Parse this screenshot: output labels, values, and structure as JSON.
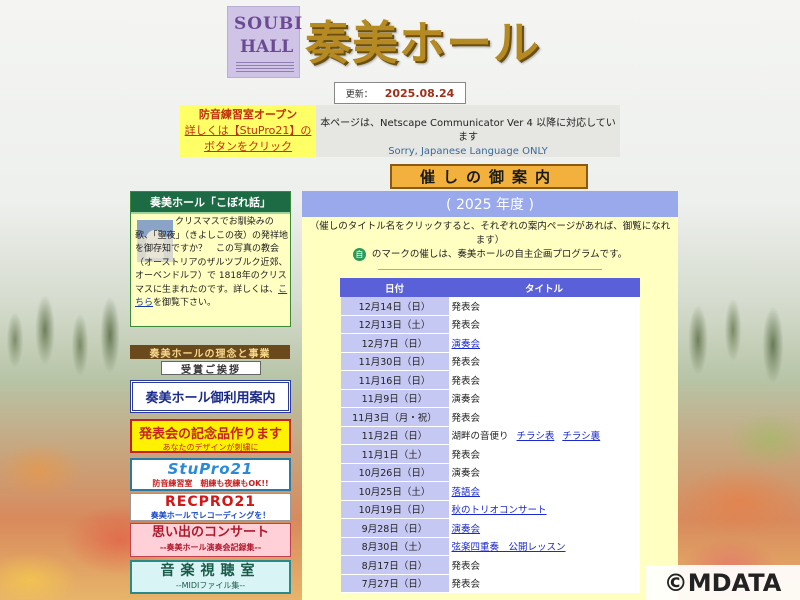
{
  "header": {
    "logo_line1": "SOUBI",
    "logo_line2": "HALL",
    "title": "奏美ホール",
    "update_label": "更新：",
    "update_date": "2025.08.24"
  },
  "notice": {
    "line1": "防音練習室オープン",
    "line2": "詳しくは【StuPro21】の",
    "line3": "ボタンをクリック",
    "browser_text": "本ページは、Netscape Communicator Ver 4 以降に対応しています",
    "browser_text_en": "Sorry, Japanese Language ONLY"
  },
  "section_title": "催しの御案内",
  "sidebar": {
    "kobore_title": "奏美ホール「こぼれ話」",
    "kobore_text": "クリスマスでお馴染みの歌、「聖夜」（きよしこの夜）の発祥地を御存知ですか？　この写真の教会（オーストリアのザルツブルク近郊、オーベンドルフ）で 1818年のクリスマスに生まれたのです。詳しくは、",
    "kobore_link": "こちら",
    "kobore_tail": "を御覧下さい。",
    "philosophy": "奏美ホールの理念と事業",
    "award": "受賞ご挨拶",
    "usage": "奏美ホール御利用案内",
    "kinen_title": "発表会の記念品作ります",
    "kinen_sub": "あなたのデザインが刺繍に",
    "stupro_title": "StuPro21",
    "stupro_sub": "防音練習室　朝練も夜練もOK!!",
    "rec_title": "RECPRO21",
    "rec_sub": "奏美ホールでレコーディングを！",
    "omoide_title": "思い出のコンサート",
    "omoide_sub": "--奏美ホール演奏会記録集--",
    "ongaku_title": "音楽視聴室",
    "ongaku_sub": "--MIDIファイル集--"
  },
  "main": {
    "year_label": "( 2025 年度 )",
    "intro1": "（催しのタイトル名をクリックすると、それぞれの案内ページがあれば、御覧になれます）",
    "own_mark": "自",
    "intro2": "のマークの催しは、奏美ホールの自主企画プログラムです。",
    "col_date": "日付",
    "col_title": "タイトル",
    "events": [
      {
        "date": "12月14日（日）",
        "title": "発表会",
        "link": false
      },
      {
        "date": "12月13日（土）",
        "title": "発表会",
        "link": false
      },
      {
        "date": "12月7日（日）",
        "title": "演奏会",
        "link": true
      },
      {
        "date": "11月30日（日）",
        "title": "発表会",
        "link": false
      },
      {
        "date": "11月16日（日）",
        "title": "発表会",
        "link": false
      },
      {
        "date": "11月9日（日）",
        "title": "演奏会",
        "link": false
      },
      {
        "date": "11月3日（月・祝）",
        "title": "発表会",
        "link": false
      },
      {
        "date": "11月2日（日）",
        "title": "湖畔の音便り",
        "link": false,
        "extra1": "チラシ表",
        "extra2": "チラシ裏"
      },
      {
        "date": "11月1日（土）",
        "title": "発表会",
        "link": false
      },
      {
        "date": "10月26日（日）",
        "title": "演奏会",
        "link": false
      },
      {
        "date": "10月25日（土）",
        "title": "落語会",
        "link": true
      },
      {
        "date": "10月19日（日）",
        "title": "秋のトリオコンサート",
        "link": true
      },
      {
        "date": "9月28日（日）",
        "title": "演奏会",
        "link": true
      },
      {
        "date": "8月30日（土）",
        "title": "弦楽四重奏　公開レッスン",
        "link": true
      },
      {
        "date": "8月17日（日）",
        "title": "発表会",
        "link": false
      },
      {
        "date": "7月27日（日）",
        "title": "発表会",
        "link": false
      }
    ]
  },
  "watermark": "©MDATA"
}
